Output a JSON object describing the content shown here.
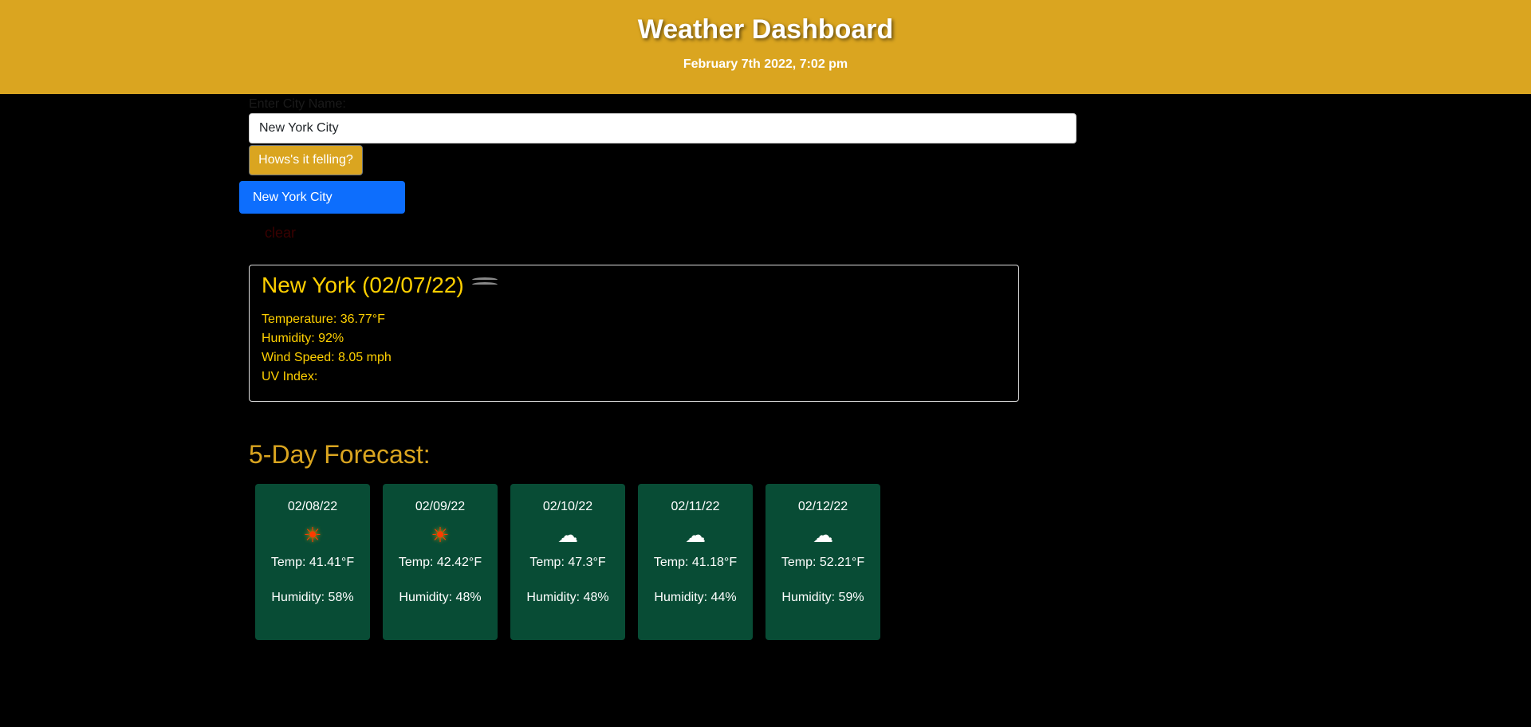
{
  "header": {
    "title": "Weather Dashboard",
    "date": "February 7th 2022, 7:02 pm"
  },
  "search": {
    "label": "Enter City Name:",
    "value": "New York City",
    "button_label": "Hows's it felling?"
  },
  "history": {
    "items": [
      "New York City"
    ],
    "clear_label": "clear"
  },
  "current": {
    "title": "New York (02/07/22)",
    "icon": "mist-icon",
    "temperature": "Temperature: 36.77°F",
    "humidity": "Humidity: 92%",
    "wind": "Wind Speed: 8.05 mph",
    "uv": "UV Index:"
  },
  "forecast": {
    "title": "5-Day Forecast:",
    "days": [
      {
        "date": "02/08/22",
        "icon": "sun-icon",
        "glyph": "☀",
        "temp": "Temp: 41.41°F",
        "humidity": "Humidity: 58%"
      },
      {
        "date": "02/09/22",
        "icon": "sun-icon",
        "glyph": "☀",
        "temp": "Temp: 42.42°F",
        "humidity": "Humidity: 48%"
      },
      {
        "date": "02/10/22",
        "icon": "cloud-icon",
        "glyph": "☁",
        "temp": "Temp: 47.3°F",
        "humidity": "Humidity: 48%"
      },
      {
        "date": "02/11/22",
        "icon": "cloud-icon",
        "glyph": "☁",
        "temp": "Temp: 41.18°F",
        "humidity": "Humidity: 44%"
      },
      {
        "date": "02/12/22",
        "icon": "cloud-icon",
        "glyph": "☁",
        "temp": "Temp: 52.21°F",
        "humidity": "Humidity: 59%"
      }
    ]
  },
  "colors": {
    "header_bg": "#DAA520",
    "card_bg": "#084C35",
    "history_bg": "#0d6efd",
    "current_text": "#FFD000"
  }
}
